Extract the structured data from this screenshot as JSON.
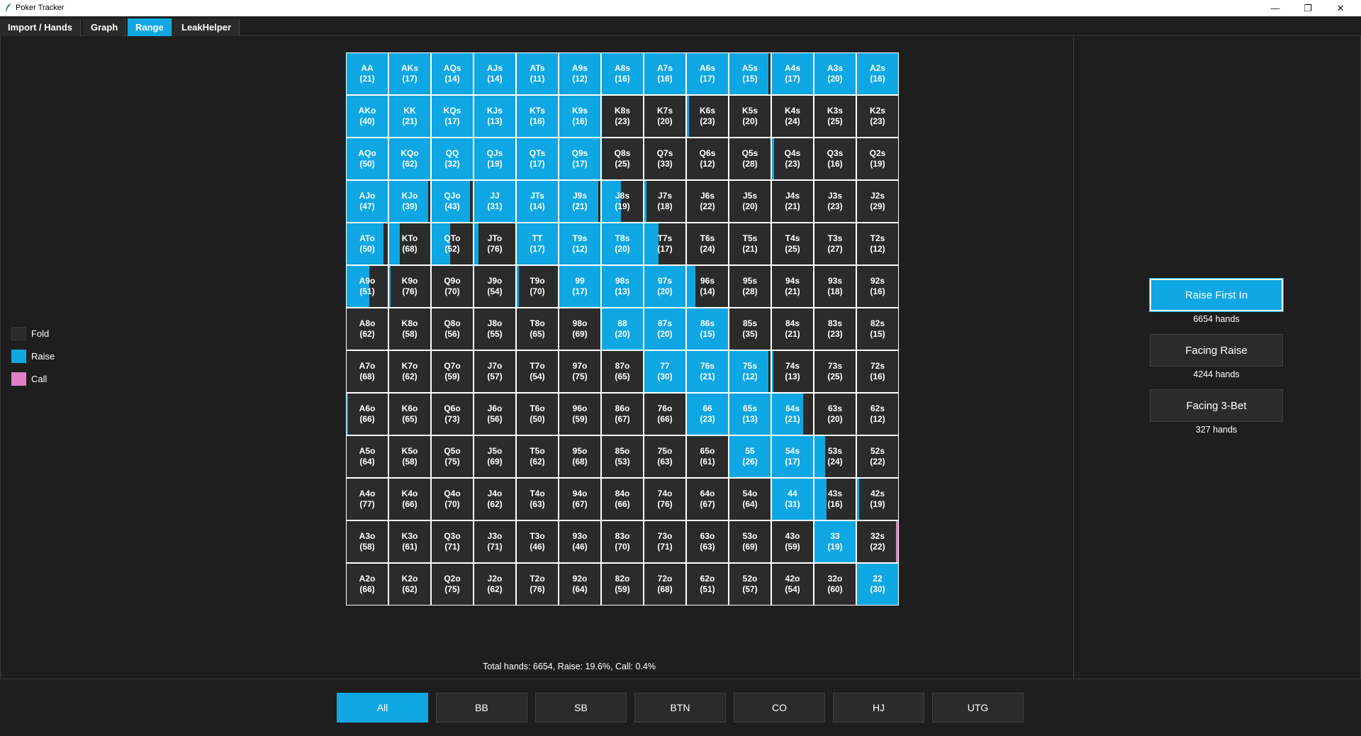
{
  "window": {
    "title": "Poker Tracker",
    "controls": [
      "—",
      "❐",
      "✕"
    ]
  },
  "tabs": [
    {
      "label": "Import / Hands",
      "active": false
    },
    {
      "label": "Graph",
      "active": false
    },
    {
      "label": "Range",
      "active": true
    },
    {
      "label": "LeakHelper",
      "active": false
    }
  ],
  "legend": [
    {
      "label": "Fold",
      "color": "#2b2b2b"
    },
    {
      "label": "Raise",
      "color": "#0fa7e3"
    },
    {
      "label": "Call",
      "color": "#e07fc8"
    }
  ],
  "colors": {
    "fold": "#2b2b2b",
    "raise": "#0fa7e3",
    "call": "#e07fc8",
    "accent": "#0fa7e3"
  },
  "range_grid": {
    "rows": [
      [
        [
          "AA",
          21,
          1,
          0
        ],
        [
          "AKs",
          17,
          1,
          0
        ],
        [
          "AQs",
          14,
          1,
          0
        ],
        [
          "AJs",
          14,
          1,
          0
        ],
        [
          "ATs",
          11,
          1,
          0
        ],
        [
          "A9s",
          12,
          1,
          0
        ],
        [
          "A8s",
          16,
          1,
          0
        ],
        [
          "A7s",
          16,
          1,
          0
        ],
        [
          "A6s",
          17,
          1,
          0
        ],
        [
          "A5s",
          15,
          0.95,
          0
        ],
        [
          "A4s",
          17,
          1,
          0
        ],
        [
          "A3s",
          20,
          1,
          0
        ],
        [
          "A2s",
          16,
          1,
          0
        ]
      ],
      [
        [
          "AKo",
          40,
          1,
          0
        ],
        [
          "KK",
          21,
          1,
          0
        ],
        [
          "KQs",
          17,
          1,
          0
        ],
        [
          "KJs",
          13,
          1,
          0
        ],
        [
          "KTs",
          16,
          1,
          0
        ],
        [
          "K9s",
          16,
          1,
          0
        ],
        [
          "K8s",
          23,
          0,
          0
        ],
        [
          "K7s",
          20,
          0,
          0
        ],
        [
          "K6s",
          23,
          0.05,
          0
        ],
        [
          "K5s",
          20,
          0,
          0
        ],
        [
          "K4s",
          24,
          0,
          0
        ],
        [
          "K3s",
          25,
          0,
          0
        ],
        [
          "K2s",
          23,
          0,
          0
        ]
      ],
      [
        [
          "AQo",
          50,
          1,
          0
        ],
        [
          "KQo",
          62,
          1,
          0
        ],
        [
          "QQ",
          32,
          1,
          0
        ],
        [
          "QJs",
          19,
          1,
          0
        ],
        [
          "QTs",
          17,
          1,
          0
        ],
        [
          "Q9s",
          17,
          1,
          0
        ],
        [
          "Q8s",
          25,
          0,
          0
        ],
        [
          "Q7s",
          33,
          0,
          0
        ],
        [
          "Q6s",
          12,
          0,
          0
        ],
        [
          "Q5s",
          28,
          0,
          0
        ],
        [
          "Q4s",
          23,
          0.05,
          0
        ],
        [
          "Q3s",
          16,
          0,
          0
        ],
        [
          "Q2s",
          19,
          0,
          0
        ]
      ],
      [
        [
          "AJo",
          47,
          1,
          0
        ],
        [
          "KJo",
          39,
          0.95,
          0
        ],
        [
          "QJo",
          43,
          0.93,
          0
        ],
        [
          "JJ",
          31,
          1,
          0
        ],
        [
          "JTs",
          14,
          1,
          0
        ],
        [
          "J9s",
          21,
          0.95,
          0
        ],
        [
          "J8s",
          19,
          0.47,
          0
        ],
        [
          "J7s",
          18,
          0.05,
          0
        ],
        [
          "J6s",
          22,
          0,
          0
        ],
        [
          "J5s",
          20,
          0,
          0
        ],
        [
          "J4s",
          21,
          0,
          0
        ],
        [
          "J3s",
          23,
          0,
          0
        ],
        [
          "J2s",
          29,
          0,
          0
        ]
      ],
      [
        [
          "ATo",
          50,
          0.9,
          0
        ],
        [
          "KTo",
          68,
          0.25,
          0
        ],
        [
          "QTo",
          52,
          0.45,
          0
        ],
        [
          "JTo",
          76,
          0.1,
          0
        ],
        [
          "TT",
          17,
          1,
          0
        ],
        [
          "T9s",
          12,
          1,
          0
        ],
        [
          "T8s",
          20,
          1,
          0
        ],
        [
          "T7s",
          17,
          0.35,
          0
        ],
        [
          "T6s",
          24,
          0,
          0
        ],
        [
          "T5s",
          21,
          0,
          0
        ],
        [
          "T4s",
          25,
          0,
          0
        ],
        [
          "T3s",
          27,
          0,
          0
        ],
        [
          "T2s",
          12,
          0,
          0
        ]
      ],
      [
        [
          "A9o",
          51,
          0.55,
          0
        ],
        [
          "K9o",
          76,
          0.03,
          0
        ],
        [
          "Q9o",
          70,
          0,
          0
        ],
        [
          "J9o",
          54,
          0,
          0
        ],
        [
          "T9o",
          70,
          0.05,
          0
        ],
        [
          "99",
          17,
          1,
          0
        ],
        [
          "98s",
          13,
          1,
          0
        ],
        [
          "97s",
          20,
          1,
          0
        ],
        [
          "96s",
          14,
          0.2,
          0
        ],
        [
          "95s",
          28,
          0,
          0
        ],
        [
          "94s",
          21,
          0,
          0
        ],
        [
          "93s",
          18,
          0,
          0
        ],
        [
          "92s",
          16,
          0,
          0
        ]
      ],
      [
        [
          "A8o",
          62,
          0,
          0
        ],
        [
          "K8o",
          58,
          0,
          0
        ],
        [
          "Q8o",
          56,
          0,
          0
        ],
        [
          "J8o",
          55,
          0,
          0
        ],
        [
          "T8o",
          65,
          0,
          0
        ],
        [
          "98o",
          69,
          0,
          0
        ],
        [
          "88",
          20,
          1,
          0
        ],
        [
          "87s",
          20,
          1,
          0
        ],
        [
          "86s",
          15,
          1,
          0
        ],
        [
          "85s",
          35,
          0,
          0
        ],
        [
          "84s",
          21,
          0,
          0
        ],
        [
          "83s",
          23,
          0,
          0
        ],
        [
          "82s",
          15,
          0,
          0
        ]
      ],
      [
        [
          "A7o",
          68,
          0,
          0
        ],
        [
          "K7o",
          62,
          0,
          0
        ],
        [
          "Q7o",
          59,
          0,
          0
        ],
        [
          "J7o",
          57,
          0,
          0
        ],
        [
          "T7o",
          54,
          0,
          0
        ],
        [
          "97o",
          75,
          0,
          0
        ],
        [
          "87o",
          65,
          0,
          0
        ],
        [
          "77",
          30,
          1,
          0
        ],
        [
          "76s",
          21,
          1,
          0
        ],
        [
          "75s",
          12,
          0.95,
          0
        ],
        [
          "74s",
          13,
          0.03,
          0
        ],
        [
          "73s",
          25,
          0,
          0
        ],
        [
          "72s",
          16,
          0,
          0
        ]
      ],
      [
        [
          "A6o",
          66,
          0.03,
          0
        ],
        [
          "K6o",
          65,
          0,
          0
        ],
        [
          "Q6o",
          73,
          0,
          0
        ],
        [
          "J6o",
          56,
          0,
          0
        ],
        [
          "T6o",
          50,
          0,
          0
        ],
        [
          "96o",
          59,
          0,
          0
        ],
        [
          "86o",
          67,
          0,
          0
        ],
        [
          "76o",
          66,
          0,
          0
        ],
        [
          "66",
          23,
          1,
          0
        ],
        [
          "65s",
          13,
          1,
          0
        ],
        [
          "64s",
          21,
          0.75,
          0
        ],
        [
          "63s",
          20,
          0,
          0
        ],
        [
          "62s",
          12,
          0,
          0
        ]
      ],
      [
        [
          "A5o",
          64,
          0,
          0
        ],
        [
          "K5o",
          58,
          0,
          0
        ],
        [
          "Q5o",
          75,
          0,
          0
        ],
        [
          "J5o",
          69,
          0,
          0
        ],
        [
          "T5o",
          62,
          0,
          0
        ],
        [
          "95o",
          68,
          0,
          0
        ],
        [
          "85o",
          53,
          0,
          0
        ],
        [
          "75o",
          63,
          0,
          0
        ],
        [
          "65o",
          61,
          0,
          0
        ],
        [
          "55",
          26,
          1,
          0
        ],
        [
          "54s",
          17,
          1,
          0
        ],
        [
          "53s",
          24,
          0.25,
          0
        ],
        [
          "52s",
          22,
          0,
          0
        ]
      ],
      [
        [
          "A4o",
          77,
          0,
          0
        ],
        [
          "K4o",
          66,
          0,
          0
        ],
        [
          "Q4o",
          70,
          0,
          0
        ],
        [
          "J4o",
          62,
          0,
          0
        ],
        [
          "T4o",
          63,
          0,
          0
        ],
        [
          "94o",
          67,
          0,
          0
        ],
        [
          "84o",
          66,
          0,
          0
        ],
        [
          "74o",
          76,
          0,
          0
        ],
        [
          "64o",
          67,
          0,
          0
        ],
        [
          "54o",
          64,
          0,
          0
        ],
        [
          "44",
          31,
          1,
          0
        ],
        [
          "43s",
          16,
          0.3,
          0
        ],
        [
          "42s",
          19,
          0.05,
          0
        ]
      ],
      [
        [
          "A3o",
          58,
          0,
          0
        ],
        [
          "K3o",
          61,
          0,
          0
        ],
        [
          "Q3o",
          71,
          0,
          0
        ],
        [
          "J3o",
          71,
          0,
          0
        ],
        [
          "T3o",
          46,
          0,
          0
        ],
        [
          "93o",
          46,
          0,
          0
        ],
        [
          "83o",
          70,
          0,
          0
        ],
        [
          "73o",
          71,
          0,
          0
        ],
        [
          "63o",
          63,
          0,
          0
        ],
        [
          "53o",
          69,
          0,
          0
        ],
        [
          "43o",
          59,
          0,
          0
        ],
        [
          "33",
          19,
          1,
          0
        ],
        [
          "32s",
          22,
          0,
          0.05
        ]
      ],
      [
        [
          "A2o",
          66,
          0,
          0
        ],
        [
          "K2o",
          62,
          0,
          0
        ],
        [
          "Q2o",
          75,
          0,
          0
        ],
        [
          "J2o",
          62,
          0,
          0
        ],
        [
          "T2o",
          76,
          0,
          0
        ],
        [
          "92o",
          64,
          0,
          0
        ],
        [
          "82o",
          59,
          0,
          0
        ],
        [
          "72o",
          68,
          0,
          0
        ],
        [
          "62o",
          51,
          0,
          0
        ],
        [
          "52o",
          57,
          0,
          0
        ],
        [
          "42o",
          54,
          0,
          0
        ],
        [
          "32o",
          60,
          0,
          0
        ],
        [
          "22",
          30,
          1,
          0
        ]
      ]
    ]
  },
  "summary": "Total hands: 6654, Raise: 19.6%, Call: 0.4%",
  "scenarios": [
    {
      "label": "Raise First In",
      "count": "6654 hands",
      "active": true
    },
    {
      "label": "Facing Raise",
      "count": "4244 hands",
      "active": false
    },
    {
      "label": "Facing 3-Bet",
      "count": "327 hands",
      "active": false
    }
  ],
  "positions": [
    {
      "label": "All",
      "active": true
    },
    {
      "label": "BB",
      "active": false
    },
    {
      "label": "SB",
      "active": false
    },
    {
      "label": "BTN",
      "active": false
    },
    {
      "label": "CO",
      "active": false
    },
    {
      "label": "HJ",
      "active": false
    },
    {
      "label": "UTG",
      "active": false
    }
  ]
}
